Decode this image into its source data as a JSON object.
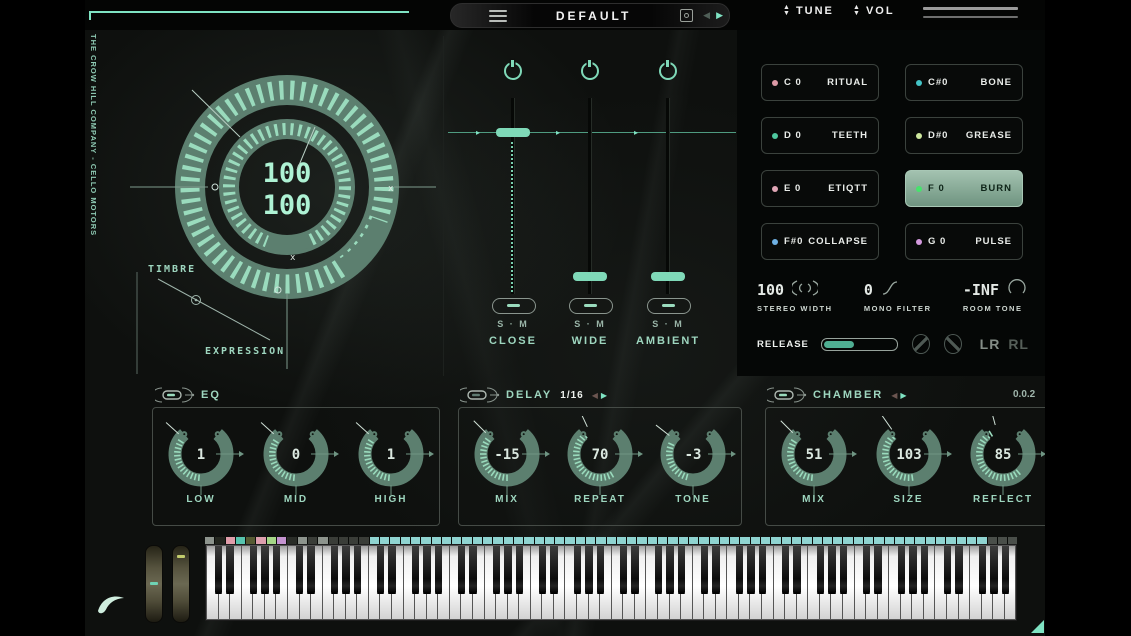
{
  "topbar": {
    "preset_name": "DEFAULT",
    "prev_icon": "◀",
    "next_icon": "▶",
    "tune_label": "TUNE",
    "vol_label": "VOL",
    "spinner_up": "▲",
    "spinner_down": "▼"
  },
  "brand": {
    "sidebar_text": "THE CROW HILL COMPANY - CELLO MOTORS"
  },
  "dial": {
    "timbre_value": "100",
    "expression_value": "100",
    "timbre_label": "TIMBRE",
    "expression_label": "EXPRESSION",
    "marker_o": "o",
    "marker_x": "x"
  },
  "faders": {
    "line_arrow": "▸",
    "items": [
      {
        "name": "CLOSE",
        "sm": "S · M",
        "position": "top",
        "dotted": true
      },
      {
        "name": "WIDE",
        "sm": "S · M",
        "position": "bottom",
        "dotted": false
      },
      {
        "name": "AMBIENT",
        "sm": "S · M",
        "position": "bottom",
        "dotted": false
      }
    ]
  },
  "articulations": [
    {
      "note": "C 0",
      "name": "RITUAL",
      "dot": "#dd9aa6",
      "selected": false
    },
    {
      "note": "C#0",
      "name": "BONE",
      "dot": "#43c3c6",
      "selected": false
    },
    {
      "note": "D 0",
      "name": "TEETH",
      "dot": "#4ec79e",
      "selected": false
    },
    {
      "note": "D#0",
      "name": "GREASE",
      "dot": "#cde79d",
      "selected": false
    },
    {
      "note": "E 0",
      "name": "ETIQTT",
      "dot": "#e0a6b6",
      "selected": false
    },
    {
      "note": "F 0",
      "name": "BURN",
      "dot": "#46e36c",
      "selected": true
    },
    {
      "note": "F#0",
      "name": "COLLAPSE",
      "dot": "#6fb1e4",
      "selected": false
    },
    {
      "note": "G 0",
      "name": "PULSE",
      "dot": "#d49ade",
      "selected": false
    }
  ],
  "params": [
    {
      "value": "100",
      "label": "STEREO WIDTH",
      "icon": "stereo-width-icon"
    },
    {
      "value": "0",
      "label": "MONO FILTER",
      "icon": "mono-filter-icon"
    },
    {
      "value": "-INF",
      "label": "ROOM TONE",
      "icon": "room-tone-icon"
    }
  ],
  "release": {
    "label": "RELEASE",
    "fill_pct": 40,
    "lr": "LR",
    "rl": "RL"
  },
  "effects": [
    {
      "title": "EQ",
      "subtitle": "",
      "arrows": false,
      "enabled": true,
      "knobs": [
        {
          "value": "1",
          "label": "LOW",
          "ticks_from": 185,
          "ticks_to": 305,
          "pointer": 312
        },
        {
          "value": "0",
          "label": "MID",
          "ticks_from": 185,
          "ticks_to": 305,
          "pointer": 312
        },
        {
          "value": "1",
          "label": "HIGH",
          "ticks_from": 185,
          "ticks_to": 305,
          "pointer": 312
        }
      ]
    },
    {
      "title": "DELAY",
      "subtitle": "1/16",
      "arrows": true,
      "enabled": false,
      "knobs": [
        {
          "value": "-15",
          "label": "MIX",
          "ticks_from": 180,
          "ticks_to": 308,
          "pointer": 315
        },
        {
          "value": "70",
          "label": "REPEAT",
          "ticks_from": 150,
          "ticks_to": 325,
          "pointer": 335
        },
        {
          "value": "-3",
          "label": "TONE",
          "ticks_from": 195,
          "ticks_to": 300,
          "pointer": 308
        }
      ]
    },
    {
      "title": "CHAMBER",
      "subtitle": "",
      "arrows": true,
      "enabled": true,
      "knobs": [
        {
          "value": "51",
          "label": "MIX",
          "ticks_from": 185,
          "ticks_to": 308,
          "pointer": 315
        },
        {
          "value": "103",
          "label": "SIZE",
          "ticks_from": 172,
          "ticks_to": 318,
          "pointer": 325
        },
        {
          "value": "85",
          "label": "REFLECT",
          "ticks_from": 140,
          "ticks_to": 335,
          "pointer": 345
        }
      ]
    }
  ],
  "version": "0.0.2",
  "keyboard": {
    "octaves": 10,
    "strip": [
      {
        "c": "#8d948d",
        "n": 1
      },
      {
        "c": "#23261f",
        "n": 1
      },
      {
        "c": "#e09daa",
        "n": 1
      },
      {
        "c": "#57c4ae",
        "n": 1
      },
      {
        "c": "#565b33",
        "n": 1
      },
      {
        "c": "#de9fae",
        "n": 1
      },
      {
        "c": "#a5d687",
        "n": 1
      },
      {
        "c": "#c493d0",
        "n": 1
      },
      {
        "c": "#2a2d28",
        "n": 1
      },
      {
        "c": "#8d948d",
        "n": 1
      },
      {
        "c": "#3a3d38",
        "n": 1
      },
      {
        "c": "#8d948d",
        "n": 1
      },
      {
        "c": "#3a3d38",
        "n": 4
      },
      {
        "c": "#8fd4d1",
        "n": 60
      },
      {
        "c": "#4a4f4a",
        "n": 3
      }
    ]
  }
}
